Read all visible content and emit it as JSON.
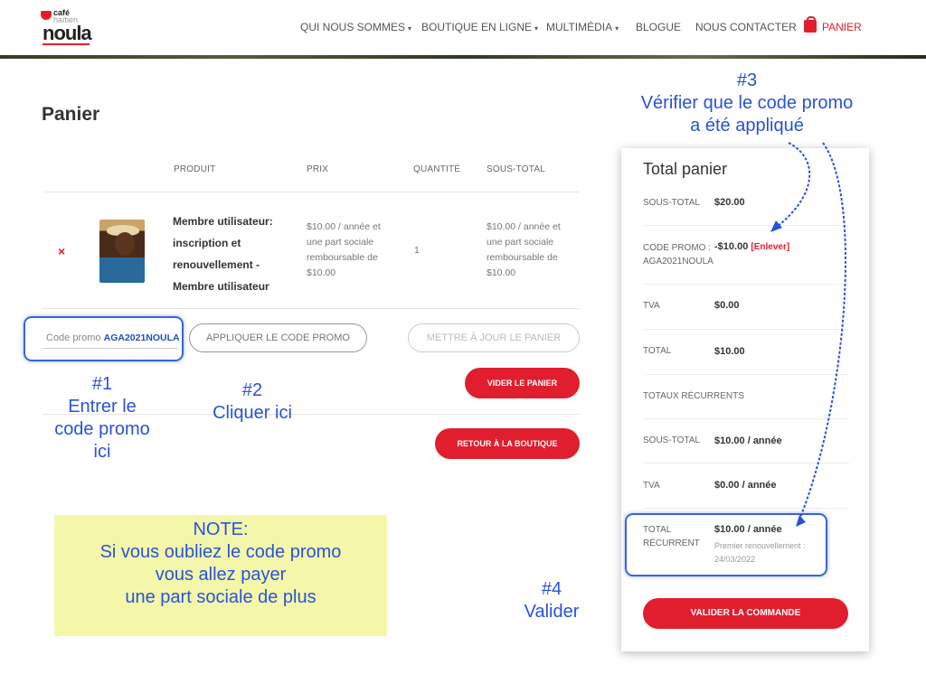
{
  "header": {
    "logo": {
      "line1": "café",
      "line2": "haïtien",
      "line3": "noula"
    },
    "nav": [
      {
        "label": "QUI NOUS SOMMES",
        "caret": "▾"
      },
      {
        "label": "BOUTIQUE EN LIGNE",
        "caret": "▾"
      },
      {
        "label": "MULTIMÉDIA",
        "caret": "▾"
      },
      {
        "label": "BLOGUE",
        "caret": ""
      },
      {
        "label": "NOUS CONTACTER",
        "caret": ""
      }
    ],
    "cart_label": "PANIER"
  },
  "page_title": "Panier",
  "table": {
    "headers": {
      "product": "PRODUIT",
      "price": "PRIX",
      "quantity": "QUANTITÉ",
      "subtotal": "SOUS-TOTAL"
    },
    "row": {
      "remove": "×",
      "name": "Membre utilisateur: inscription et renouvellement - Membre utilisateur",
      "price": "$10.00 / année et une part sociale remboursable de $10.00",
      "quantity": "1",
      "subtotal": "$10.00 / année et une part sociale remboursable de $10.00"
    }
  },
  "coupon": {
    "placeholder": "Code promo",
    "value": "AGA2021NOULA"
  },
  "buttons": {
    "apply": "APPLIQUER LE CODE PROMO",
    "update": "METTRE À JOUR LE PANIER",
    "empty": "VIDER LE PANIER",
    "back": "RETOUR À LA BOUTIQUE",
    "checkout": "VALIDER LA COMMANDE"
  },
  "annotations": {
    "a1": [
      "#1",
      "Entrer le",
      "code promo",
      "ici"
    ],
    "a2": [
      "#2",
      "Cliquer ici"
    ],
    "a3": [
      "#3",
      "Vérifier que le code promo",
      "a été appliqué"
    ],
    "a4": [
      "#4",
      "Valider"
    ]
  },
  "note": [
    "NOTE:",
    "Si vous oubliez le code promo",
    "vous allez payer",
    "une part sociale de plus"
  ],
  "totals": {
    "title": "Total panier",
    "subtotal_label": "SOUS-TOTAL",
    "subtotal_value": "$20.00",
    "promo_label": "CODE PROMO :",
    "promo_code": "AGA2021NOULA",
    "promo_value": "-$10.00",
    "promo_remove": "[Enlever]",
    "tva_label": "TVA",
    "tva_value": "$0.00",
    "total_label": "TOTAL",
    "total_value": "$10.00",
    "recurring_header": "TOTAUX RÉCURRENTS",
    "r_subtotal_label": "SOUS-TOTAL",
    "r_subtotal_value": "$10.00 / année",
    "r_tva_label": "TVA",
    "r_tva_value": "$0.00 / année",
    "r_total_label_1": "TOTAL",
    "r_total_label_2": "RÉCURRENT",
    "r_total_value": "$10.00 / année",
    "r_renewal": "Premier renouvellement :",
    "r_renewal_date": "24/03/2022"
  },
  "colors": {
    "accent": "#e01e2e",
    "annotation": "#2a52d8",
    "note_bg": "#f4f7aa"
  }
}
